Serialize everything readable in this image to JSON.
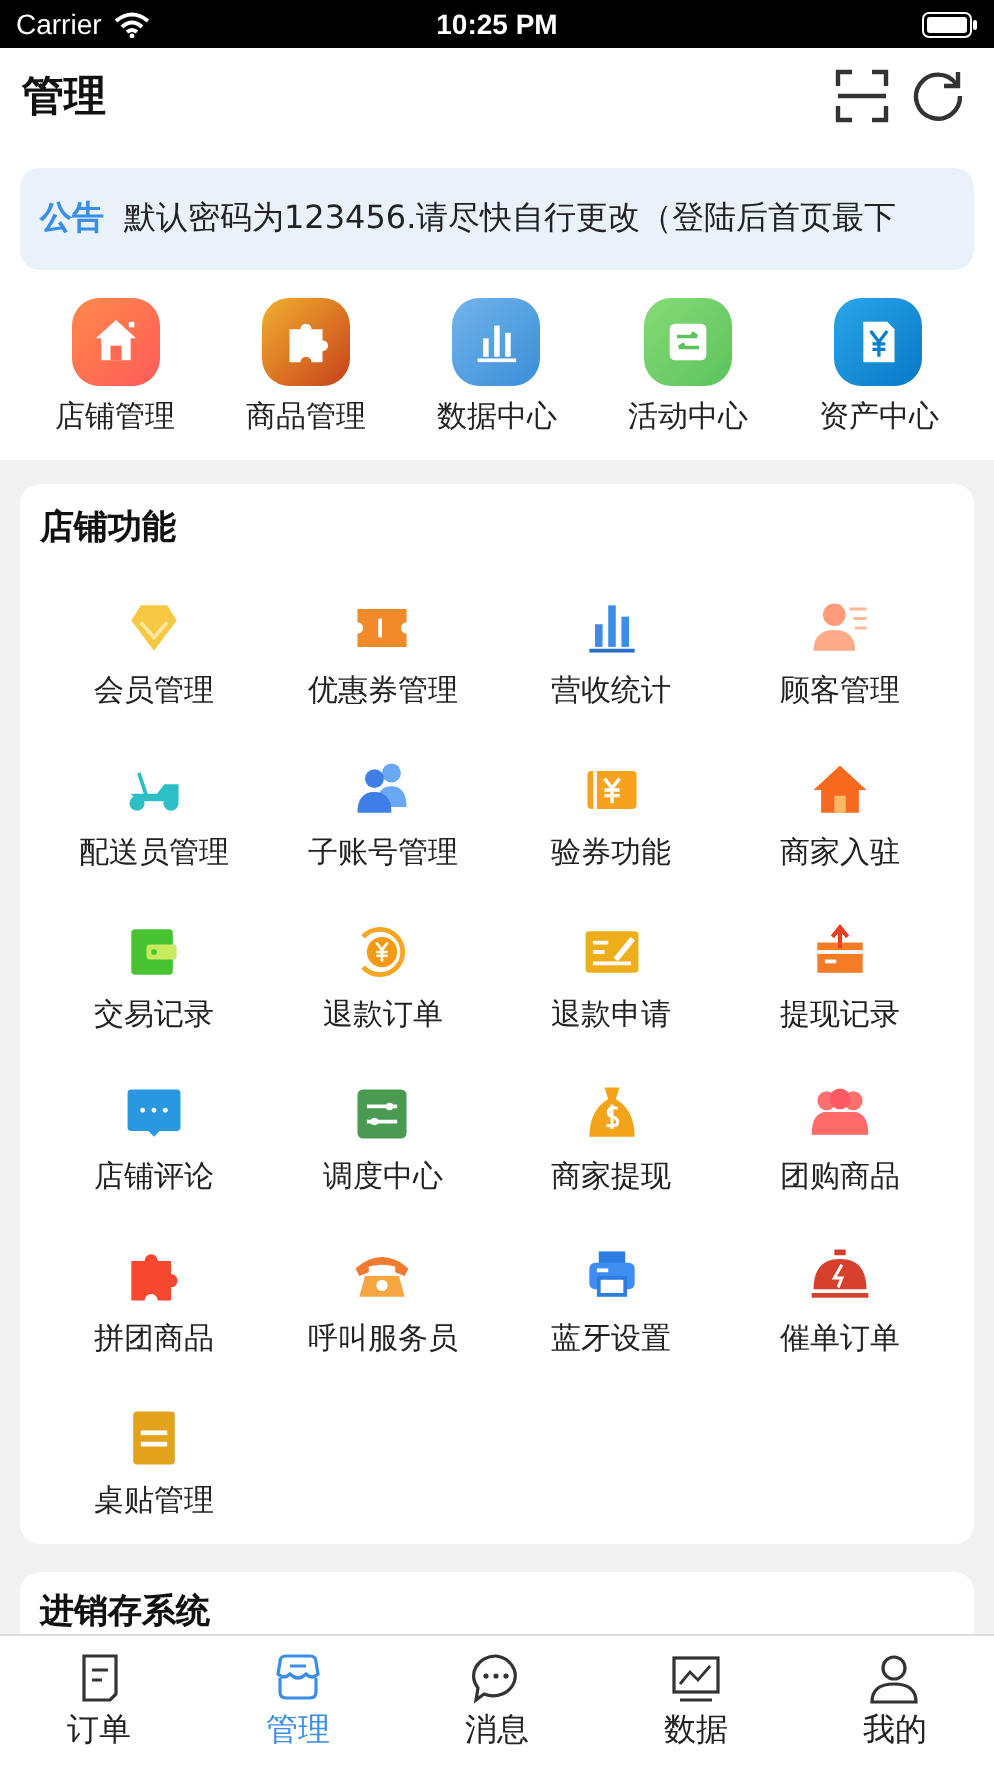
{
  "status_bar": {
    "carrier": "Carrier",
    "time": "10:25 PM"
  },
  "header": {
    "title": "管理"
  },
  "notice": {
    "label": "公告",
    "text": "默认密码为123456.请尽快自行更改（登陆后首页最下"
  },
  "quick_actions": [
    {
      "label": "店铺管理",
      "kind": "home"
    },
    {
      "label": "商品管理",
      "kind": "puzzle"
    },
    {
      "label": "数据中心",
      "kind": "chart"
    },
    {
      "label": "活动中心",
      "kind": "switch"
    },
    {
      "label": "资产中心",
      "kind": "yen"
    }
  ],
  "store_functions": {
    "title": "店铺功能",
    "items": [
      {
        "label": "会员管理",
        "kind": "diamond"
      },
      {
        "label": "优惠券管理",
        "kind": "ticket"
      },
      {
        "label": "营收统计",
        "kind": "bars"
      },
      {
        "label": "顾客管理",
        "kind": "person"
      },
      {
        "label": "配送员管理",
        "kind": "scooter"
      },
      {
        "label": "子账号管理",
        "kind": "people"
      },
      {
        "label": "验券功能",
        "kind": "voucher"
      },
      {
        "label": "商家入驻",
        "kind": "house"
      },
      {
        "label": "交易记录",
        "kind": "wallet"
      },
      {
        "label": "退款订单",
        "kind": "refund"
      },
      {
        "label": "退款申请",
        "kind": "form"
      },
      {
        "label": "提现记录",
        "kind": "upload"
      },
      {
        "label": "店铺评论",
        "kind": "chat"
      },
      {
        "label": "调度中心",
        "kind": "sliders"
      },
      {
        "label": "商家提现",
        "kind": "moneybag"
      },
      {
        "label": "团购商品",
        "kind": "group"
      },
      {
        "label": "拼团商品",
        "kind": "puzzle"
      },
      {
        "label": "呼叫服务员",
        "kind": "phone"
      },
      {
        "label": "蓝牙设置",
        "kind": "printer"
      },
      {
        "label": "催单订单",
        "kind": "bell"
      },
      {
        "label": "桌贴管理",
        "kind": "note"
      }
    ]
  },
  "inventory_section": {
    "title": "进销存系统"
  },
  "tab_bar": [
    {
      "label": "订单",
      "kind": "orders",
      "selected": false
    },
    {
      "label": "管理",
      "kind": "shop",
      "selected": true
    },
    {
      "label": "消息",
      "kind": "message",
      "selected": false
    },
    {
      "label": "数据",
      "kind": "data",
      "selected": false
    },
    {
      "label": "我的",
      "kind": "profile",
      "selected": false
    }
  ]
}
